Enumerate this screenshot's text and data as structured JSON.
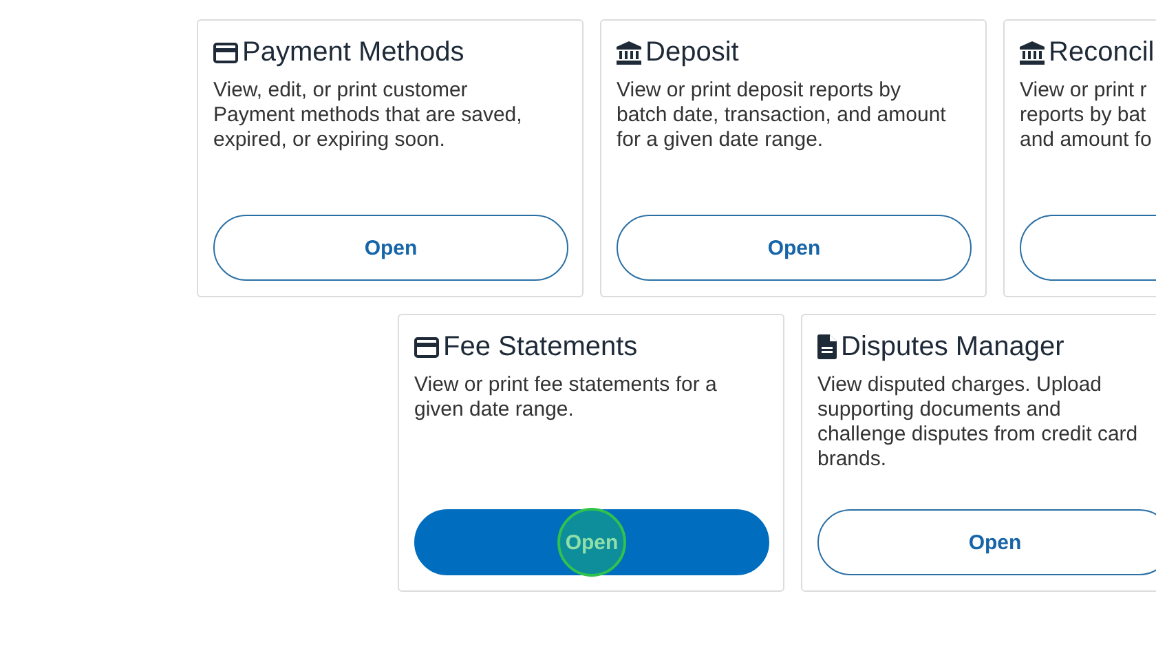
{
  "rows": [
    {
      "cards": [
        {
          "title": "Payment Methods",
          "description": [
            "View, edit, or print customer",
            "Payment methods that are saved,",
            "expired, or expiring soon."
          ],
          "button": {
            "label": "Open",
            "pressed": false
          }
        },
        {
          "title": "Deposit",
          "description": [
            "View or print deposit reports by",
            "batch date, transaction, and amount",
            "for a given date range."
          ],
          "button": {
            "label": "Open",
            "pressed": false
          }
        },
        {
          "title": "Reconcil",
          "description": [
            "View or print r",
            "reports by bat",
            "and amount fo"
          ],
          "button": {
            "pressed": false
          }
        }
      ]
    },
    {
      "cards": [
        {
          "title": "Fee Statements",
          "description": [
            "View or print fee statements for a",
            "given date range."
          ],
          "button": {
            "label": "Open",
            "pressed": true
          }
        },
        {
          "title": "Disputes Manager",
          "description": [
            "View disputed charges. Upload",
            "supporting documents and",
            "challenge disputes from credit card",
            "brands."
          ],
          "button": {
            "label": "Open",
            "pressed": false
          }
        }
      ]
    }
  ]
}
